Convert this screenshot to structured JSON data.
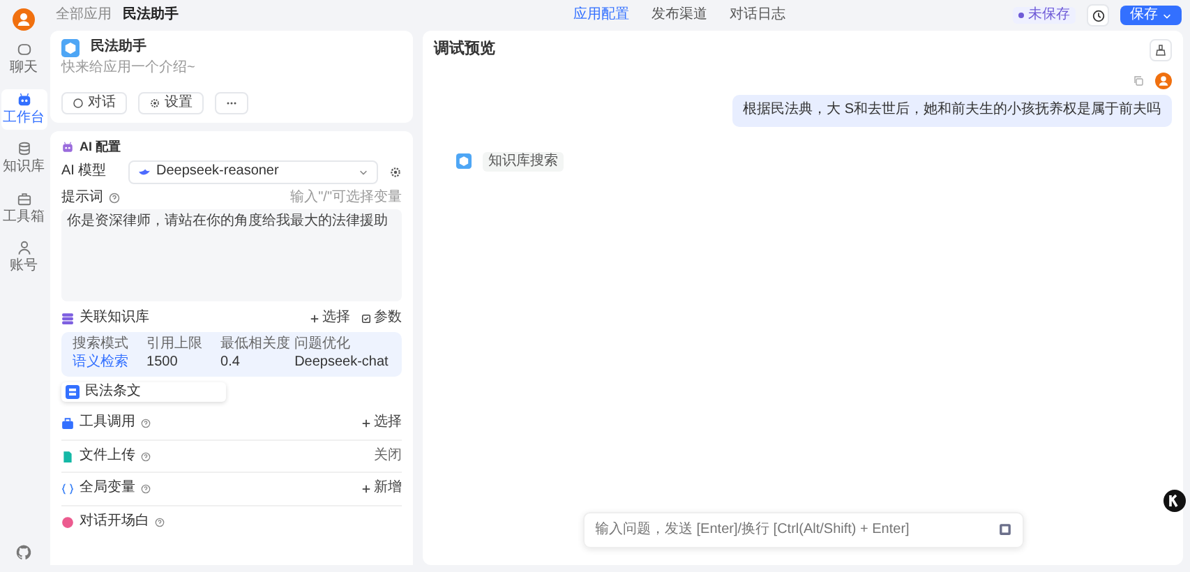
{
  "sidebar": {
    "items": [
      {
        "label": "聊天",
        "selected": false
      },
      {
        "label": "工作台",
        "selected": true
      },
      {
        "label": "知识库",
        "selected": false
      },
      {
        "label": "工具箱",
        "selected": false
      },
      {
        "label": "账号",
        "selected": false
      }
    ]
  },
  "breadcrumb": [
    "全部应用",
    "民法助手"
  ],
  "top_tabs": [
    {
      "label": "应用配置",
      "selected": true
    },
    {
      "label": "发布渠道",
      "selected": false
    },
    {
      "label": "对话日志",
      "selected": false
    }
  ],
  "save_status": "未保存",
  "save_button": "保存",
  "app": {
    "name": "民法助手",
    "intro": "快来给应用一个介绍~",
    "buttons": [
      "对话",
      "设置"
    ]
  },
  "ai_config": {
    "title": "AI 配置",
    "model_label": "AI 模型",
    "model": "Deepseek-reasoner",
    "prompt_label": "提示词",
    "prompt_hint": "输入\"/\"可选择变量",
    "prompt": "你是资深律师，请站在你的角度给我最大的法律援助"
  },
  "knowledge": {
    "title": "关联知识库",
    "actions": [
      "选择",
      "参数"
    ],
    "columns": [
      "搜索模式",
      "引用上限",
      "最低相关度",
      "问题优化"
    ],
    "values": [
      "语义检索",
      "1500",
      "0.4",
      "Deepseek-chat"
    ],
    "datasets": [
      "民法条文"
    ]
  },
  "sections": [
    {
      "title": "工具调用",
      "kind": "add",
      "action": "选择"
    },
    {
      "title": "文件上传",
      "kind": "status",
      "action": "关闭"
    },
    {
      "title": "全局变量",
      "kind": "add",
      "action": "新增"
    },
    {
      "title": "对话开场白",
      "kind": "none"
    }
  ],
  "preview": {
    "title": "调试预览",
    "messages": [
      {
        "kind": "user",
        "text": "根据民法典，大 S和去世后，她和前夫生的小孩抚养权是属于前夫吗"
      },
      {
        "kind": "ai",
        "tag": "知识库搜索"
      }
    ],
    "input_placeholder": "输入问题，发送 [Enter]/换行 [Ctrl(Alt/Shift) + Enter]"
  }
}
